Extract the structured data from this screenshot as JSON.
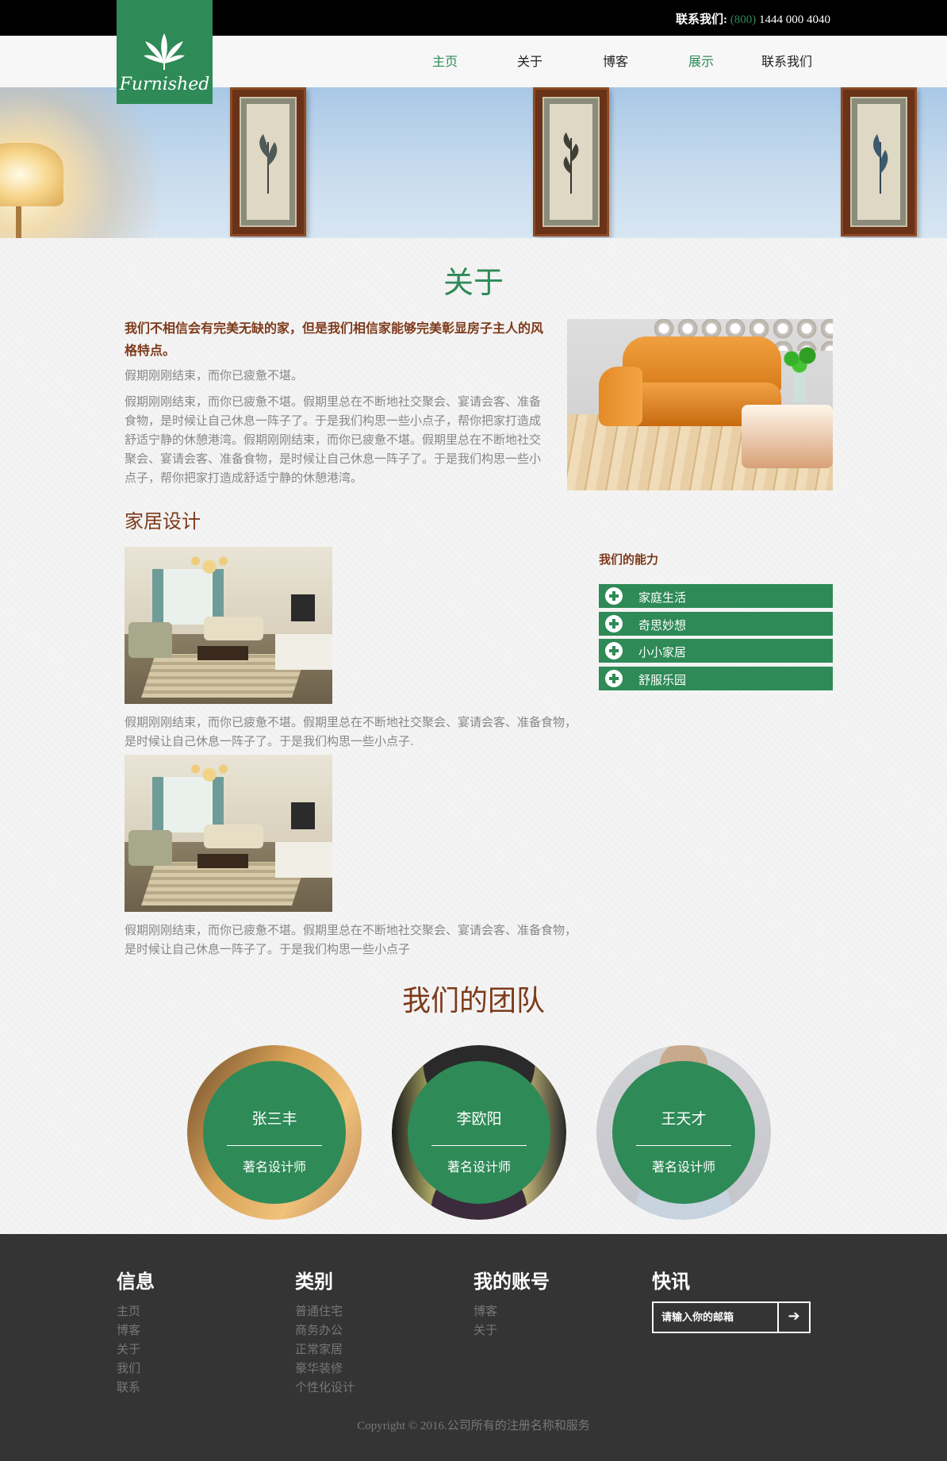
{
  "topbar": {
    "contact_label": "联系我们:",
    "area_code": "(800)",
    "phone": "1444 000 4040"
  },
  "logo": {
    "text": "Furnished",
    "icon": "cannabis-leaf-icon"
  },
  "nav": {
    "items": [
      {
        "label": "主页",
        "active": true
      },
      {
        "label": "关于",
        "active": false
      },
      {
        "label": "博客",
        "active": false
      },
      {
        "label": "展示",
        "active": true
      },
      {
        "label": "联系我们",
        "active": false
      }
    ]
  },
  "about": {
    "title": "关于",
    "lead": "我们不相信会有完美无缺的家，但是我们相信家能够完美彰显房子主人的风格特点。",
    "short": "假期刚刚结束，而你已疲惫不堪。",
    "long": "假期刚刚结束，而你已疲惫不堪。假期里总在不断地社交聚会、宴请会客、准备食物，是时候让自己休息一阵子了。于是我们构思一些小点子，帮你把家打造成舒适宁静的休憩港湾。假期刚刚结束，而你已疲惫不堪。假期里总在不断地社交聚会、宴请会客、准备食物，是时候让自己休息一阵子了。于是我们构思一些小点子，帮你把家打造成舒适宁静的休憩港湾。"
  },
  "home_design": {
    "title": "家居设计",
    "items": [
      {
        "caption": "假期刚刚结束，而你已疲惫不堪。假期里总在不断地社交聚会、宴请会客、准备食物，是时候让自己休息一阵子了。于是我们构思一些小点子."
      },
      {
        "caption": "假期刚刚结束，而你已疲惫不堪。假期里总在不断地社交聚会、宴请会客、准备食物，是时候让自己休息一阵子了。于是我们构思一些小点子"
      }
    ]
  },
  "abilities": {
    "title": "我们的能力",
    "items": [
      "家庭生活",
      "奇思妙想",
      "小小家居",
      "舒服乐园"
    ]
  },
  "team": {
    "title": "我们的团队",
    "members": [
      {
        "name": "张三丰",
        "role": "著名设计师"
      },
      {
        "name": "李欧阳",
        "role": "著名设计师"
      },
      {
        "name": "王天才",
        "role": "著名设计师"
      }
    ]
  },
  "footer": {
    "columns": [
      {
        "title": "信息",
        "links": [
          "主页",
          "博客",
          "关于",
          "我们",
          "联系"
        ]
      },
      {
        "title": "类别",
        "links": [
          "普通住宅",
          "商务办公",
          "正常家居",
          "豪华装修",
          "个性化设计"
        ]
      },
      {
        "title": "我的账号",
        "links": [
          "博客",
          "关于"
        ]
      }
    ],
    "newsletter": {
      "title": "快讯",
      "placeholder": "请输入你的邮箱",
      "button_icon": "arrow-right-icon"
    },
    "copyright": "Copyright © 2016.公司所有的注册名称和服务"
  },
  "colors": {
    "accent": "#2e8a57",
    "brown": "#7d3a1a",
    "footer_bg": "#343434"
  }
}
